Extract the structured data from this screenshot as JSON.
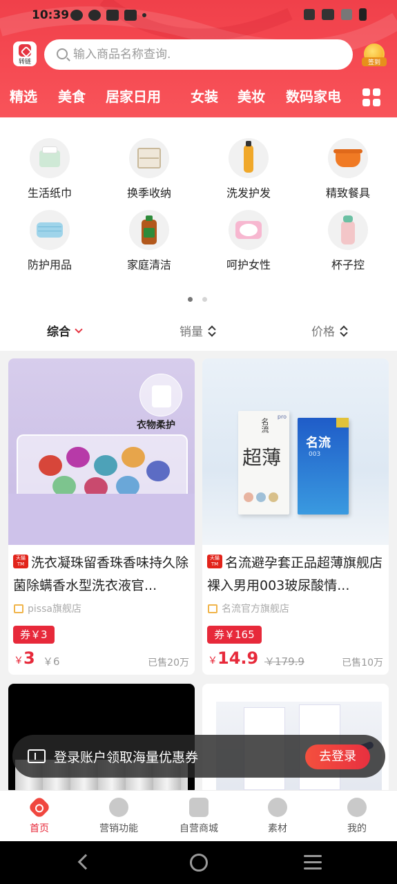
{
  "status": {
    "time": "10:39"
  },
  "header": {
    "zhuanlian_label": "转链",
    "search_placeholder": "输入商品名称查询.",
    "badge_label": "签到",
    "categories": [
      "精选",
      "美食",
      "居家日用",
      "女装",
      "美妆",
      "数码家电"
    ]
  },
  "subcategories": [
    {
      "label": "生活纸巾",
      "icon": "tissue-icon"
    },
    {
      "label": "换季收纳",
      "icon": "storage-icon"
    },
    {
      "label": "洗发护发",
      "icon": "shampoo-icon"
    },
    {
      "label": "精致餐具",
      "icon": "pot-icon"
    },
    {
      "label": "防护用品",
      "icon": "mask-icon"
    },
    {
      "label": "家庭清洁",
      "icon": "cleaner-icon"
    },
    {
      "label": "呵护女性",
      "icon": "pad-icon"
    },
    {
      "label": "杯子控",
      "icon": "cup-icon"
    }
  ],
  "sort": {
    "comprehensive": "综合",
    "sales": "销量",
    "price": "价格"
  },
  "products": [
    {
      "title": "洗衣凝珠留香珠香味持久除菌除螨香水型洗衣液官...",
      "shop": "pissa旗舰店",
      "coupon": "券￥3",
      "currency": "￥",
      "price": "3",
      "old_price": "￥6",
      "sold": "已售20万",
      "image_tag": "衣物柔护"
    },
    {
      "title": "名流避孕套正品超薄旗舰店裸入男用003玻尿酸情...",
      "shop": "名流官方旗舰店",
      "coupon": "券￥165",
      "currency": "￥",
      "price": "14.9",
      "old_price": "￥179.9",
      "sold": "已售10万",
      "image_texts": [
        "pro",
        "名流",
        "超薄",
        "名流",
        "003"
      ]
    }
  ],
  "toast": {
    "message": "登录账户领取海量优惠券",
    "button": "去登录"
  },
  "tabs": [
    "首页",
    "营销功能",
    "自营商城",
    "素材",
    "我的"
  ],
  "colors": {
    "brand_red": "#e7293a",
    "header_red": "#f0404a"
  }
}
